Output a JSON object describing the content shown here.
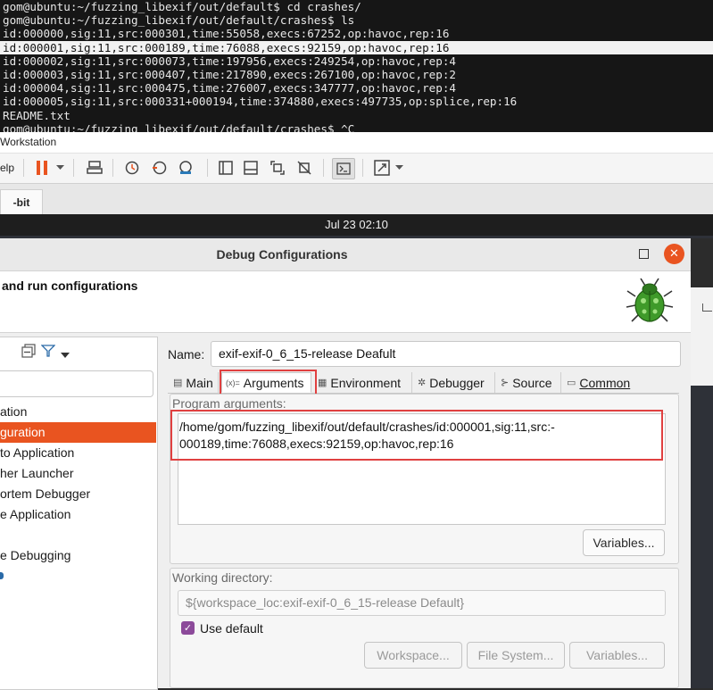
{
  "terminal": {
    "lines": [
      "gom@ubuntu:~/fuzzing_libexif/out/default$ cd crashes/",
      "gom@ubuntu:~/fuzzing_libexif/out/default/crashes$ ls",
      "id:000000,sig:11,src:000301,time:55058,execs:67252,op:havoc,rep:16",
      "id:000001,sig:11,src:000189,time:76088,execs:92159,op:havoc,rep:16",
      "id:000002,sig:11,src:000073,time:197956,execs:249254,op:havoc,rep:4",
      "id:000003,sig:11,src:000407,time:217890,execs:267100,op:havoc,rep:2",
      "id:000004,sig:11,src:000475,time:276007,execs:347777,op:havoc,rep:4",
      "id:000005,sig:11,src:000331+000194,time:374880,execs:497735,op:splice,rep:16",
      "README.txt",
      "gom@ubuntu:~/fuzzing_libexif/out/default/crashes$ ^C"
    ],
    "selected_line": 3
  },
  "vmware": {
    "title": "Workstation",
    "menu_fragment": "elp",
    "tab_label": "-bit"
  },
  "topbar": {
    "clock": "Jul 23  02:10"
  },
  "dialog": {
    "title": "Debug Configurations",
    "header": "and run configurations",
    "close_glyph": "✕",
    "config_list": [
      "ation",
      "guration",
      "to Application",
      "her Launcher",
      "ortem Debugger",
      "e Application",
      "",
      "e Debugging"
    ],
    "selected_index": 1,
    "name_label": "Name:",
    "name_value": "exif-exif-0_6_15-release Deafult",
    "tabs": [
      {
        "label": "Main",
        "icon": "main-tab-icon",
        "glyph": "▤"
      },
      {
        "label": "Arguments",
        "icon": "arguments-tab-icon",
        "glyph": "(x)="
      },
      {
        "label": "Environment",
        "icon": "environment-tab-icon",
        "glyph": "▦"
      },
      {
        "label": "Debugger",
        "icon": "debugger-tab-icon",
        "glyph": "✲"
      },
      {
        "label": "Source",
        "icon": "source-tab-icon",
        "glyph": "⊱"
      },
      {
        "label": "Common",
        "icon": "common-tab-icon",
        "glyph": "▭"
      }
    ],
    "active_tab": "Arguments",
    "program_args_label": "Program arguments:",
    "program_args": [
      "/home/gom/fuzzing_libexif/out/default/crashes/id:000001,sig:11,src:-",
      "000189,time:76088,execs:92159,op:havoc,rep:16"
    ],
    "variables_button": "Variables...",
    "working_dir_label": "Working directory:",
    "working_dir_value": "${workspace_loc:exif-exif-0_6_15-release Default}",
    "use_default_label": "Use default",
    "use_default_checked": true,
    "workspace_button": "Workspace...",
    "filesystem_button": "File System...",
    "variables_button_2": "Variables..."
  },
  "colors": {
    "accent": "#e95420",
    "highlight": "#e04040",
    "terminal_bg": "#161616",
    "checkbox": "#8c4a9a"
  }
}
